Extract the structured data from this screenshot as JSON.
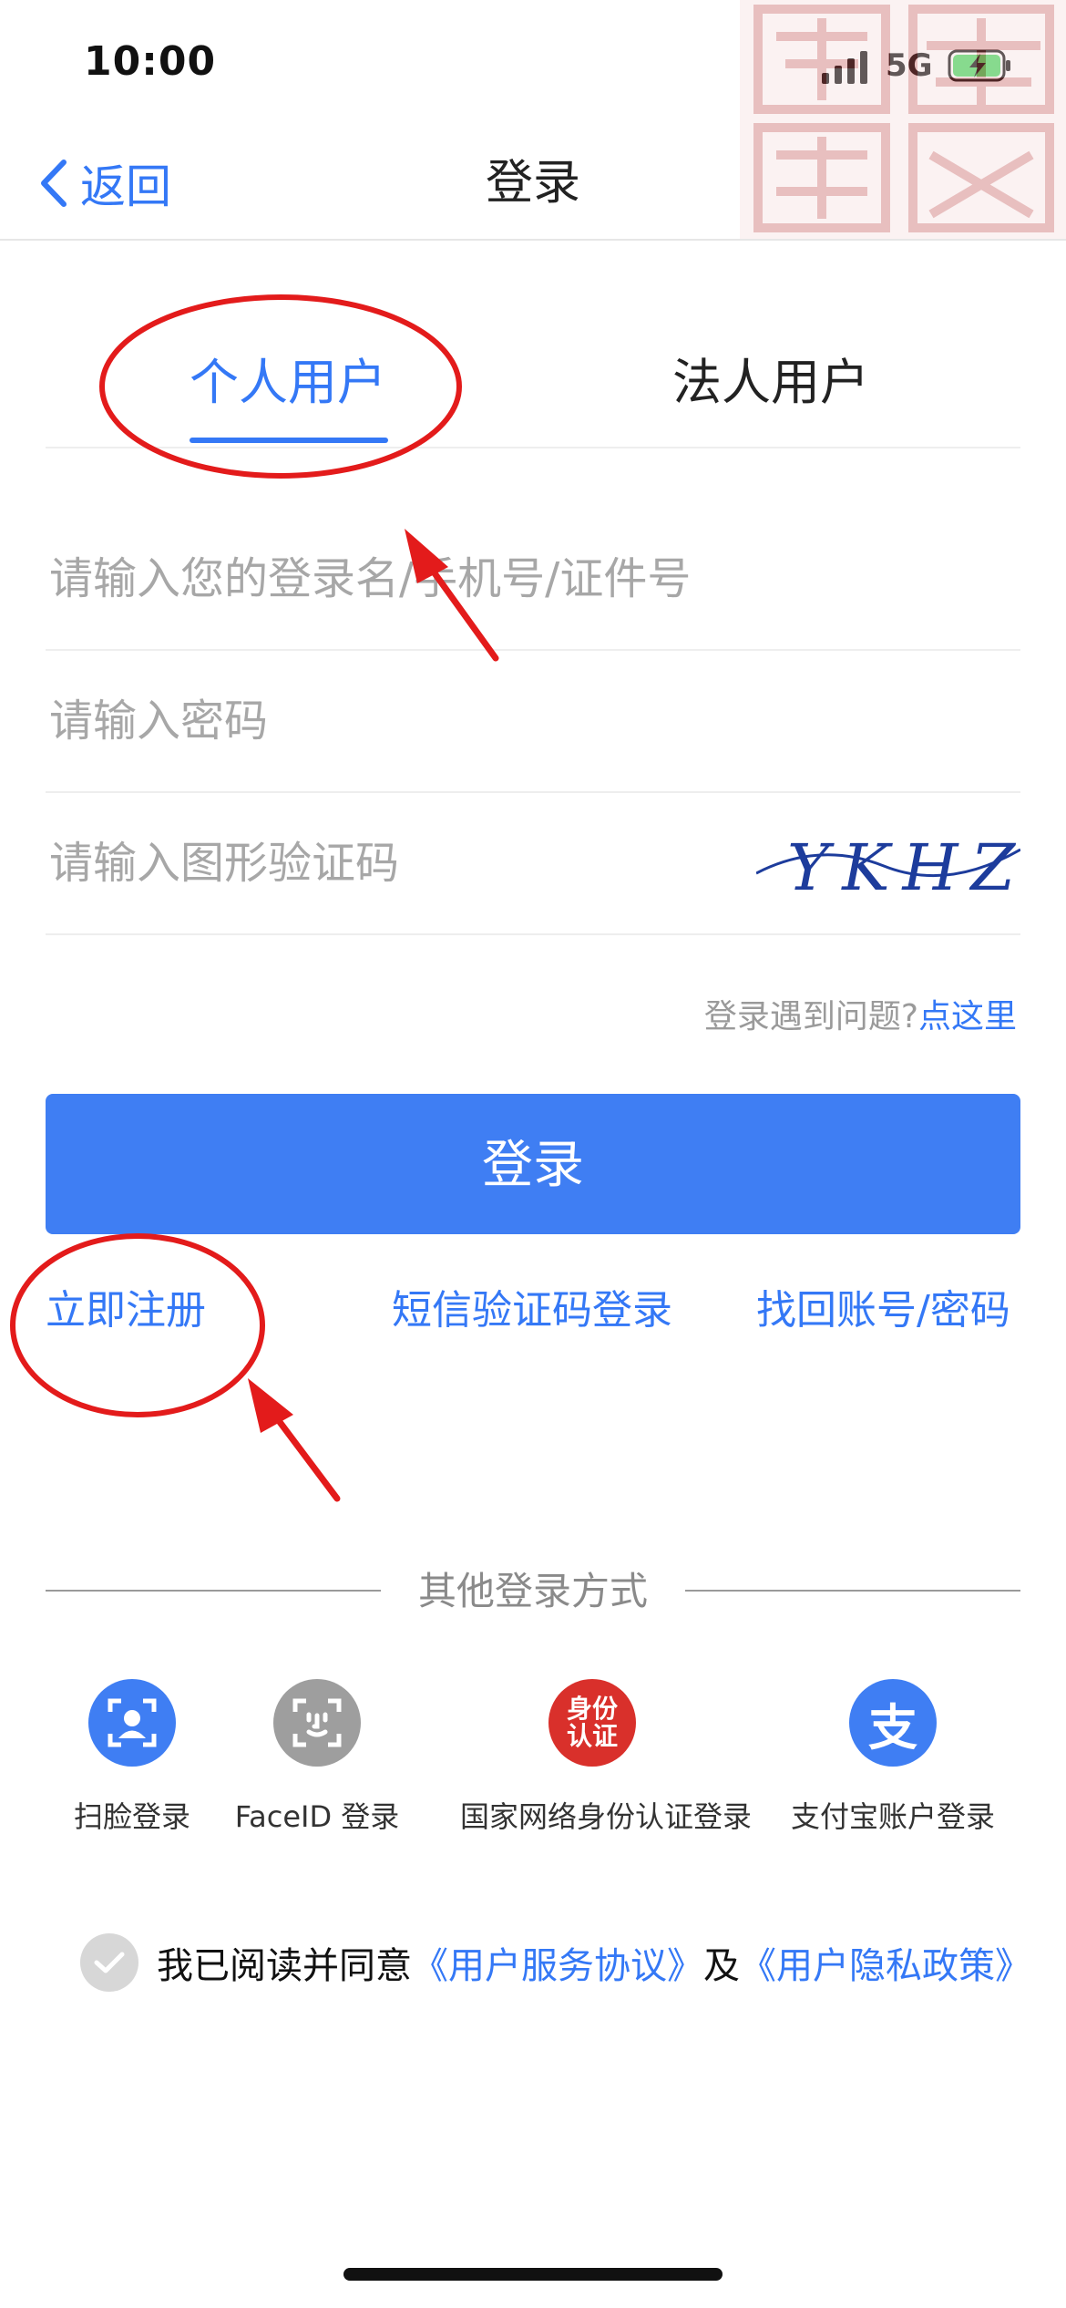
{
  "status_bar": {
    "time": "10:00",
    "network": "5G"
  },
  "nav": {
    "back_label": "返回",
    "title": "登录"
  },
  "tabs": [
    {
      "label": "个人用户",
      "active": true
    },
    {
      "label": "法人用户",
      "active": false
    }
  ],
  "form": {
    "username_placeholder": "请输入您的登录名/手机号/证件号",
    "password_placeholder": "请输入密码",
    "captcha_placeholder": "请输入图形验证码",
    "captcha_text": "YKHZ",
    "help_prefix": "登录遇到问题?",
    "help_link": "点这里",
    "login_button": "登录"
  },
  "links": {
    "register": "立即注册",
    "sms_login": "短信验证码登录",
    "recover": "找回账号/密码"
  },
  "other_login": {
    "title": "其他登录方式",
    "methods": [
      {
        "label": "扫脸登录",
        "icon": "face-scan-icon",
        "color": "#3f7ef3"
      },
      {
        "label": "FaceID 登录",
        "icon": "faceid-icon",
        "color": "#9e9e9e"
      },
      {
        "label": "国家网络身份认证登录",
        "icon": "national-id-icon",
        "icon_text": "身份认证",
        "color": "#d9302b"
      },
      {
        "label": "支付宝账户登录",
        "icon": "alipay-icon",
        "icon_text": "支",
        "color": "#3f7ef3"
      }
    ]
  },
  "agreement": {
    "prefix": "我已阅读并同意",
    "terms": "《用户服务协议》",
    "conjunction": "及",
    "privacy": "《用户隐私政策》"
  },
  "colors": {
    "accent": "#3478f6",
    "button": "#3f7ef3",
    "annotation": "#e31b1b"
  }
}
